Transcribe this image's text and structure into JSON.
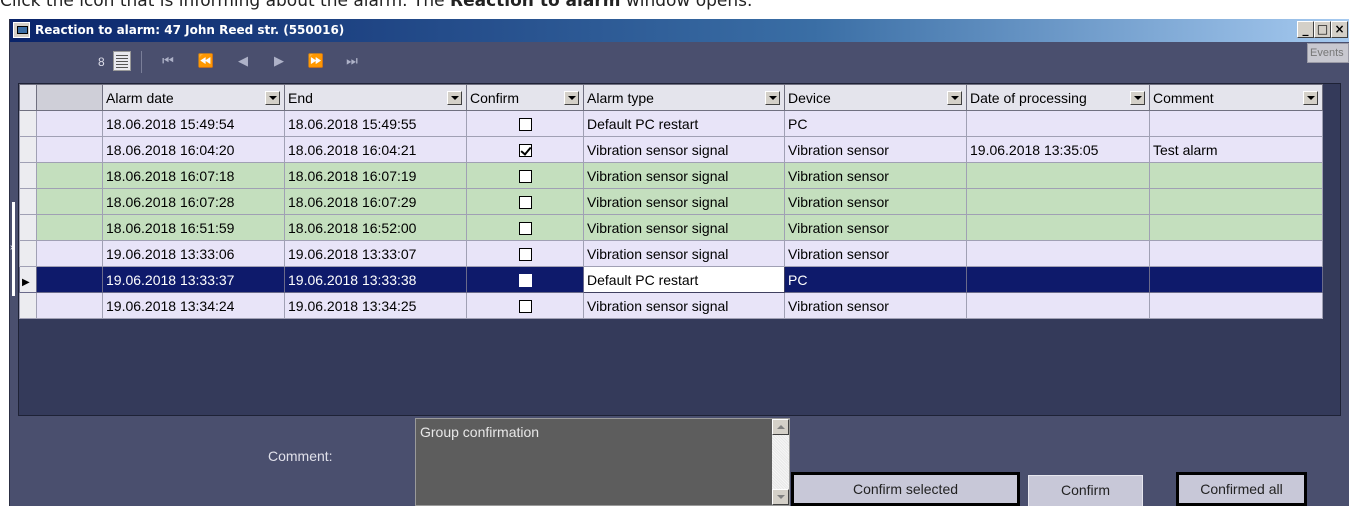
{
  "caption": {
    "prefix": "Click the icon that is informing about the alarm. The ",
    "bold": "Reaction to alarm",
    "suffix": " window opens."
  },
  "window": {
    "title": "Reaction to alarm: 47 John Reed str. (550016)",
    "min_glyph": "_",
    "max_glyph": "□",
    "close_glyph": "×"
  },
  "toolbar": {
    "record_count": "8",
    "events_tab": "Events",
    "nav": [
      "⏮",
      "⏪",
      "◀",
      "▶",
      "⏩",
      "⏭"
    ]
  },
  "table": {
    "columns": [
      "Alarm date",
      "End",
      "Confirm",
      "Alarm type",
      "Device",
      "Date of processing",
      "Comment"
    ],
    "rows": [
      {
        "alarm_date": "18.06.2018 15:49:54",
        "end": "18.06.2018 15:49:55",
        "confirmed": false,
        "alarm_type": "Default PC restart",
        "device": "PC",
        "processed": "",
        "comment": "",
        "style": "normal"
      },
      {
        "alarm_date": "18.06.2018 16:04:20",
        "end": "18.06.2018 16:04:21",
        "confirmed": true,
        "alarm_type": "Vibration sensor signal",
        "device": "Vibration sensor",
        "processed": "19.06.2018 13:35:05",
        "comment": "Test alarm",
        "style": "normal"
      },
      {
        "alarm_date": "18.06.2018 16:07:18",
        "end": "18.06.2018 16:07:19",
        "confirmed": false,
        "alarm_type": "Vibration sensor signal",
        "device": "Vibration sensor",
        "processed": "",
        "comment": "",
        "style": "green"
      },
      {
        "alarm_date": "18.06.2018 16:07:28",
        "end": "18.06.2018 16:07:29",
        "confirmed": false,
        "alarm_type": "Vibration sensor signal",
        "device": "Vibration sensor",
        "processed": "",
        "comment": "",
        "style": "green"
      },
      {
        "alarm_date": "18.06.2018 16:51:59",
        "end": "18.06.2018 16:52:00",
        "confirmed": false,
        "alarm_type": "Vibration sensor signal",
        "device": "Vibration sensor",
        "processed": "",
        "comment": "",
        "style": "green"
      },
      {
        "alarm_date": "19.06.2018 13:33:06",
        "end": "19.06.2018 13:33:07",
        "confirmed": false,
        "alarm_type": "Vibration sensor signal",
        "device": "Vibration sensor",
        "processed": "",
        "comment": "",
        "style": "normal"
      },
      {
        "alarm_date": "19.06.2018 13:33:37",
        "end": "19.06.2018 13:33:38",
        "confirmed": false,
        "alarm_type": "Default PC restart",
        "device": "PC",
        "processed": "",
        "comment": "",
        "style": "selected"
      },
      {
        "alarm_date": "19.06.2018 13:34:24",
        "end": "19.06.2018 13:34:25",
        "confirmed": false,
        "alarm_type": "Vibration sensor signal",
        "device": "Vibration sensor",
        "processed": "",
        "comment": "",
        "style": "normal"
      }
    ]
  },
  "bottom": {
    "comment_label": "Comment:",
    "comment_value": "Group confirmation",
    "confirm_selected_label": "Confirm selected",
    "confirm_label": "Confirm",
    "confirmed_all_label": "Confirmed all"
  },
  "colors": {
    "panel": "#4a4f6e",
    "grid_bg": "#343a5a",
    "row_normal": "#e8e4f8",
    "row_green": "#c4dfbe",
    "row_selected": "#0e1a6b"
  }
}
